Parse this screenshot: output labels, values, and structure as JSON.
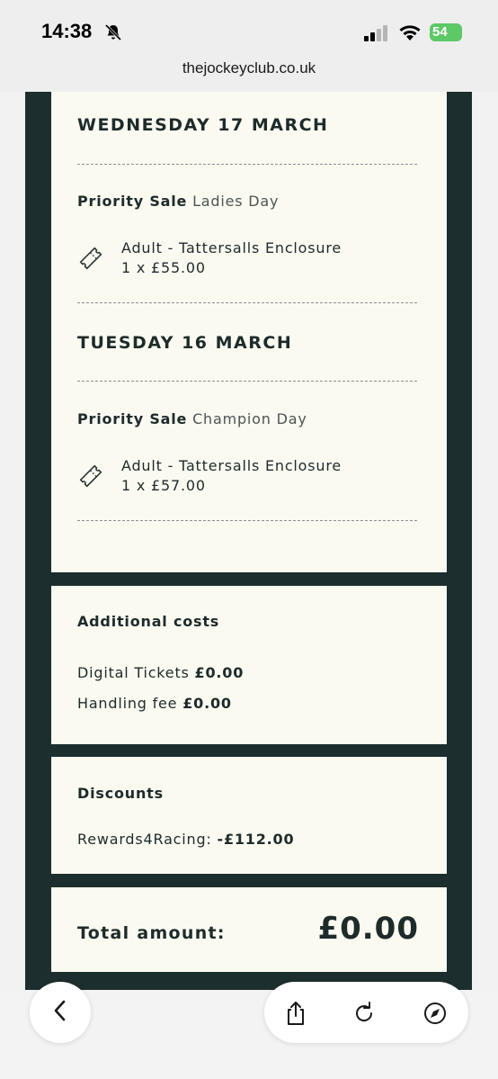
{
  "status_bar": {
    "time": "14:38",
    "battery": "54"
  },
  "browser": {
    "url": "thejockeyclub.co.uk"
  },
  "orders": [
    {
      "date": "WEDNESDAY 17 MARCH",
      "sale_type": "Priority Sale",
      "event": "Ladies Day",
      "ticket_name": "Adult - Tattersalls Enclosure",
      "ticket_price": "1 x £55.00"
    },
    {
      "date": "TUESDAY 16 MARCH",
      "sale_type": "Priority Sale",
      "event": "Champion Day",
      "ticket_name": "Adult - Tattersalls Enclosure",
      "ticket_price": "1 x £57.00"
    }
  ],
  "additional_costs": {
    "heading": "Additional costs",
    "items": [
      {
        "label": "Digital Tickets",
        "value": "£0.00"
      },
      {
        "label": "Handling fee",
        "value": "£0.00"
      }
    ]
  },
  "discounts": {
    "heading": "Discounts",
    "items": [
      {
        "label": "Rewards4Racing:",
        "value": "-£112.00"
      }
    ]
  },
  "total": {
    "label": "Total amount:",
    "value": "£0.00"
  },
  "icons": {
    "ticket": "ticket-icon",
    "back": "chevron-left-icon",
    "share": "share-icon",
    "reload": "reload-icon",
    "compass": "compass-icon"
  },
  "colors": {
    "page_background": "#1c2e2e",
    "card_background": "#fbfaf1",
    "text": "#1d2b2b",
    "battery": "#5dc866"
  }
}
